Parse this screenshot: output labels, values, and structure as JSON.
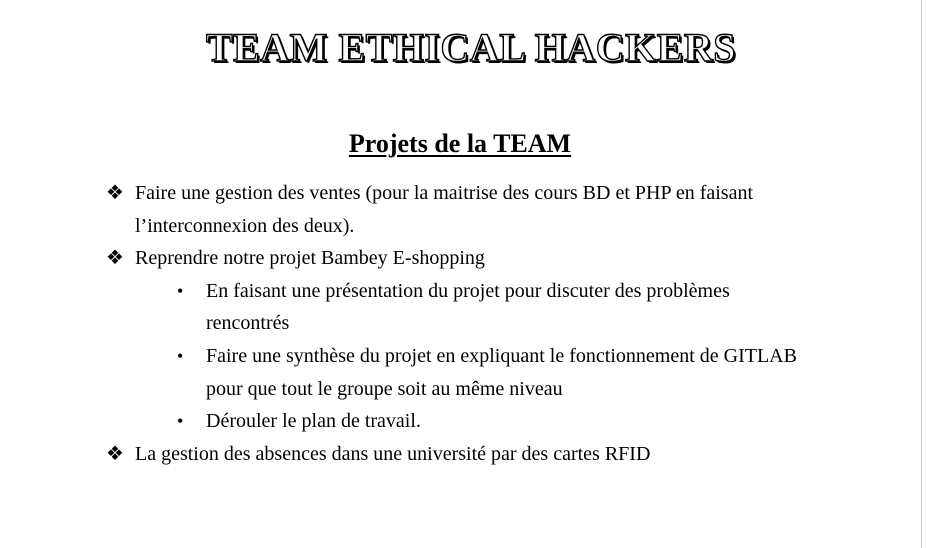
{
  "document": {
    "title": "TEAM ETHICAL HACKERS",
    "section_title": "Projets de la TEAM",
    "items": [
      {
        "text": "Faire une gestion des ventes (pour la maitrise des cours BD et PHP en faisant l’interconnexion des deux)."
      },
      {
        "text": "Reprendre notre projet Bambey E-shopping",
        "subitems": [
          {
            "text": "En faisant une présentation du projet pour discuter des problèmes rencontrés"
          },
          {
            "text": "Faire une synthèse du projet en expliquant le fonctionnement de GITLAB pour que tout le groupe soit au même niveau"
          },
          {
            "text": "Dérouler le plan de travail."
          }
        ]
      },
      {
        "text": "La gestion des absences dans une université par des cartes RFID"
      }
    ]
  },
  "icons": {
    "level1_bullet": "diamond-four-petal-icon",
    "level2_bullet": "round-bullet-icon"
  },
  "colors": {
    "text": "#000000",
    "page_background": "#ffffff",
    "page_edge": "#c8c8c8"
  }
}
